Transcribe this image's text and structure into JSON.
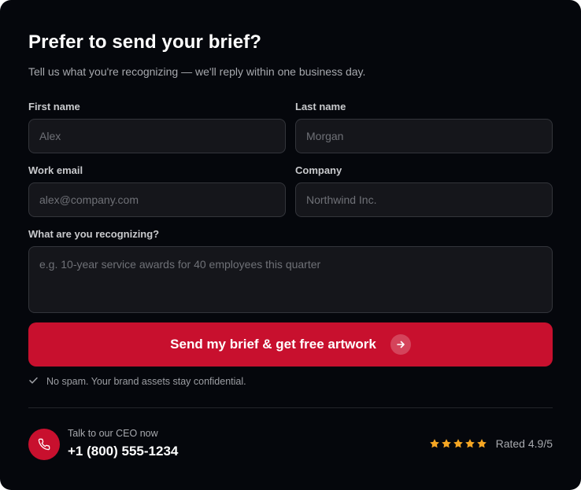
{
  "form": {
    "title": "Prefer to send your brief?",
    "subtitle": "Tell us what you're recognizing — we'll reply within one business day.",
    "first_name": {
      "label": "First name",
      "placeholder": "Alex",
      "value": ""
    },
    "last_name": {
      "label": "Last name",
      "placeholder": "Morgan",
      "value": ""
    },
    "work_email": {
      "label": "Work email",
      "placeholder": "alex@company.com",
      "value": ""
    },
    "company": {
      "label": "Company",
      "placeholder": "Northwind Inc.",
      "value": ""
    },
    "recognizing": {
      "label": "What are you recognizing?",
      "placeholder": "e.g. 10-year service awards for 40 employees this quarter",
      "value": ""
    },
    "submit_label": "Send my brief & get free artwork",
    "privacy_note": "No spam. Your brand assets stay confidential."
  },
  "footer": {
    "ceo_label": "Talk to our CEO now",
    "phone": "+1 (800) 555-1234",
    "rating_text": "Rated 4.9/5",
    "stars": 5
  },
  "colors": {
    "background": "#05070c",
    "accent": "#c8102e",
    "field_bg": "#15161b",
    "star": "#f5a623"
  },
  "icons": {
    "submit": "arrow-right-icon",
    "note": "check-icon",
    "contact": "phone-icon",
    "rating": "star-icon"
  }
}
